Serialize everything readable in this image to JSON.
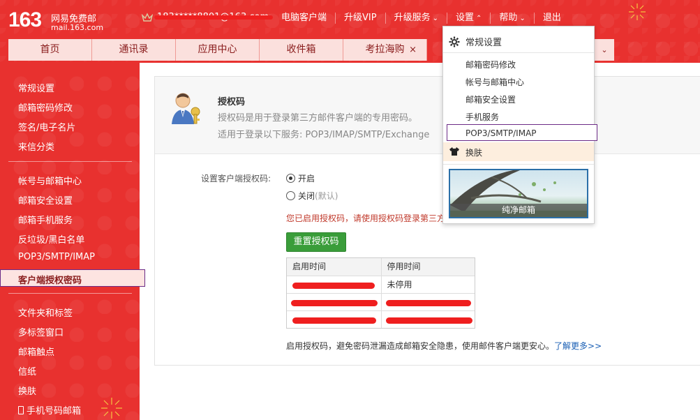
{
  "brand": {
    "number": "163",
    "name_cn": "网易免费邮",
    "domain": "mail.163.com"
  },
  "account": {
    "email_masked": "183*****8801@163.com"
  },
  "toplinks": [
    {
      "label": "电脑客户端"
    },
    {
      "label": "升级VIP"
    },
    {
      "label": "升级服务"
    },
    {
      "label": "设置"
    },
    {
      "label": "帮助"
    },
    {
      "label": "退出"
    }
  ],
  "navtabs": [
    {
      "label": "首页"
    },
    {
      "label": "通讯录"
    },
    {
      "label": "应用中心"
    },
    {
      "label": "收件箱"
    },
    {
      "label": "考拉海购"
    }
  ],
  "sidebar": {
    "items": [
      {
        "label": "常规设置"
      },
      {
        "label": "邮箱密码修改"
      },
      {
        "label": "签名/电子名片"
      },
      {
        "label": "来信分类"
      },
      {
        "label": "帐号与邮箱中心"
      },
      {
        "label": "邮箱安全设置"
      },
      {
        "label": "邮箱手机服务"
      },
      {
        "label": "反垃圾/黑白名单"
      },
      {
        "label": "POP3/SMTP/IMAP"
      },
      {
        "label": "客户端授权密码"
      },
      {
        "label": "文件夹和标签"
      },
      {
        "label": "多标签窗口"
      },
      {
        "label": "邮箱触点"
      },
      {
        "label": "信纸"
      },
      {
        "label": "换肤"
      },
      {
        "label": "手机号码邮箱"
      }
    ]
  },
  "panel": {
    "title": "授权码",
    "description": "授权码是用于登录第三方邮件客户端的专用密码。",
    "services": "适用于登录以下服务: POP3/IMAP/SMTP/Exchange",
    "setting_label": "设置客户端授权码:",
    "option_on": "开启",
    "option_off": "关闭",
    "option_off_hint": "(默认)",
    "warning": "您已启用授权码，请使用授权码登录第三方",
    "reset_button": "重置授权码",
    "table": {
      "headers": [
        "启用时间",
        "停用时间"
      ],
      "rows": [
        [
          "",
          "未停用"
        ],
        [
          "",
          ""
        ],
        [
          "",
          ""
        ]
      ]
    },
    "footnote": "启用授权码，避免密码泄漏造成邮箱安全隐患，使用邮件客户端更安心。",
    "footnote_link": "了解更多>>"
  },
  "settings_menu": {
    "general": "常规设置",
    "items": [
      {
        "label": "邮箱密码修改"
      },
      {
        "label": "帐号与邮箱中心"
      },
      {
        "label": "邮箱安全设置"
      },
      {
        "label": "手机服务"
      },
      {
        "label": "POP3/SMTP/IMAP"
      }
    ],
    "skin": "换肤",
    "skin_thumb_caption": "纯净邮箱"
  },
  "colors": {
    "brand_red": "#e8312f",
    "active_border": "#6b2a86",
    "button_green": "#3a9d3a",
    "link_blue": "#1a5fb4"
  }
}
